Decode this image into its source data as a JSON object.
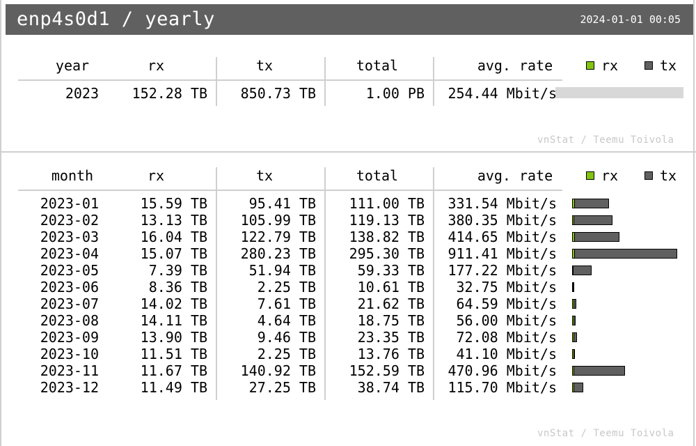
{
  "header": {
    "title": "enp4s0d1 / yearly",
    "timestamp": "2024-01-01 00:05"
  },
  "watermark": "vnStat / Teemu Toivola",
  "legend": {
    "rx": "rx",
    "tx": "tx"
  },
  "colors": {
    "rx": "#82c411",
    "tx": "#606060",
    "track": "#d8d8d8",
    "header_bg": "#606060"
  },
  "chart_data": [
    {
      "type": "table",
      "columns": [
        "year",
        "rx",
        "tx",
        "total",
        "avg. rate"
      ],
      "rows": [
        {
          "label": "2023",
          "rx": "152.28 TB",
          "tx": "850.73 TB",
          "total": "1.00 PB",
          "rate": "254.44 Mbit/s",
          "rx_frac": 0.0,
          "tx_frac": 0.0
        }
      ]
    },
    {
      "type": "bar",
      "columns": [
        "month",
        "rx",
        "tx",
        "total",
        "avg. rate"
      ],
      "rows": [
        {
          "label": "2023-01",
          "rx": "15.59 TB",
          "tx": "95.41 TB",
          "total": "111.00 TB",
          "rate": "331.54 Mbit/s",
          "rx_tb": 15.59,
          "tx_tb": 95.41
        },
        {
          "label": "2023-02",
          "rx": "13.13 TB",
          "tx": "105.99 TB",
          "total": "119.13 TB",
          "rate": "380.35 Mbit/s",
          "rx_tb": 13.13,
          "tx_tb": 105.99
        },
        {
          "label": "2023-03",
          "rx": "16.04 TB",
          "tx": "122.79 TB",
          "total": "138.82 TB",
          "rate": "414.65 Mbit/s",
          "rx_tb": 16.04,
          "tx_tb": 122.79
        },
        {
          "label": "2023-04",
          "rx": "15.07 TB",
          "tx": "280.23 TB",
          "total": "295.30 TB",
          "rate": "911.41 Mbit/s",
          "rx_tb": 15.07,
          "tx_tb": 280.23
        },
        {
          "label": "2023-05",
          "rx": "7.39 TB",
          "tx": "51.94 TB",
          "total": "59.33 TB",
          "rate": "177.22 Mbit/s",
          "rx_tb": 7.39,
          "tx_tb": 51.94
        },
        {
          "label": "2023-06",
          "rx": "8.36 TB",
          "tx": "2.25 TB",
          "total": "10.61 TB",
          "rate": "32.75 Mbit/s",
          "rx_tb": 8.36,
          "tx_tb": 2.25
        },
        {
          "label": "2023-07",
          "rx": "14.02 TB",
          "tx": "7.61 TB",
          "total": "21.62 TB",
          "rate": "64.59 Mbit/s",
          "rx_tb": 14.02,
          "tx_tb": 7.61
        },
        {
          "label": "2023-08",
          "rx": "14.11 TB",
          "tx": "4.64 TB",
          "total": "18.75 TB",
          "rate": "56.00 Mbit/s",
          "rx_tb": 14.11,
          "tx_tb": 4.64
        },
        {
          "label": "2023-09",
          "rx": "13.90 TB",
          "tx": "9.46 TB",
          "total": "23.35 TB",
          "rate": "72.08 Mbit/s",
          "rx_tb": 13.9,
          "tx_tb": 9.46
        },
        {
          "label": "2023-10",
          "rx": "11.51 TB",
          "tx": "2.25 TB",
          "total": "13.76 TB",
          "rate": "41.10 Mbit/s",
          "rx_tb": 11.51,
          "tx_tb": 2.25
        },
        {
          "label": "2023-11",
          "rx": "11.67 TB",
          "tx": "140.92 TB",
          "total": "152.59 TB",
          "rate": "470.96 Mbit/s",
          "rx_tb": 11.67,
          "tx_tb": 140.92
        },
        {
          "label": "2023-12",
          "rx": "11.49 TB",
          "tx": "27.25 TB",
          "total": "38.74 TB",
          "rate": "115.70 Mbit/s",
          "rx_tb": 11.49,
          "tx_tb": 27.25
        }
      ],
      "max_total_tb": 295.3
    }
  ]
}
